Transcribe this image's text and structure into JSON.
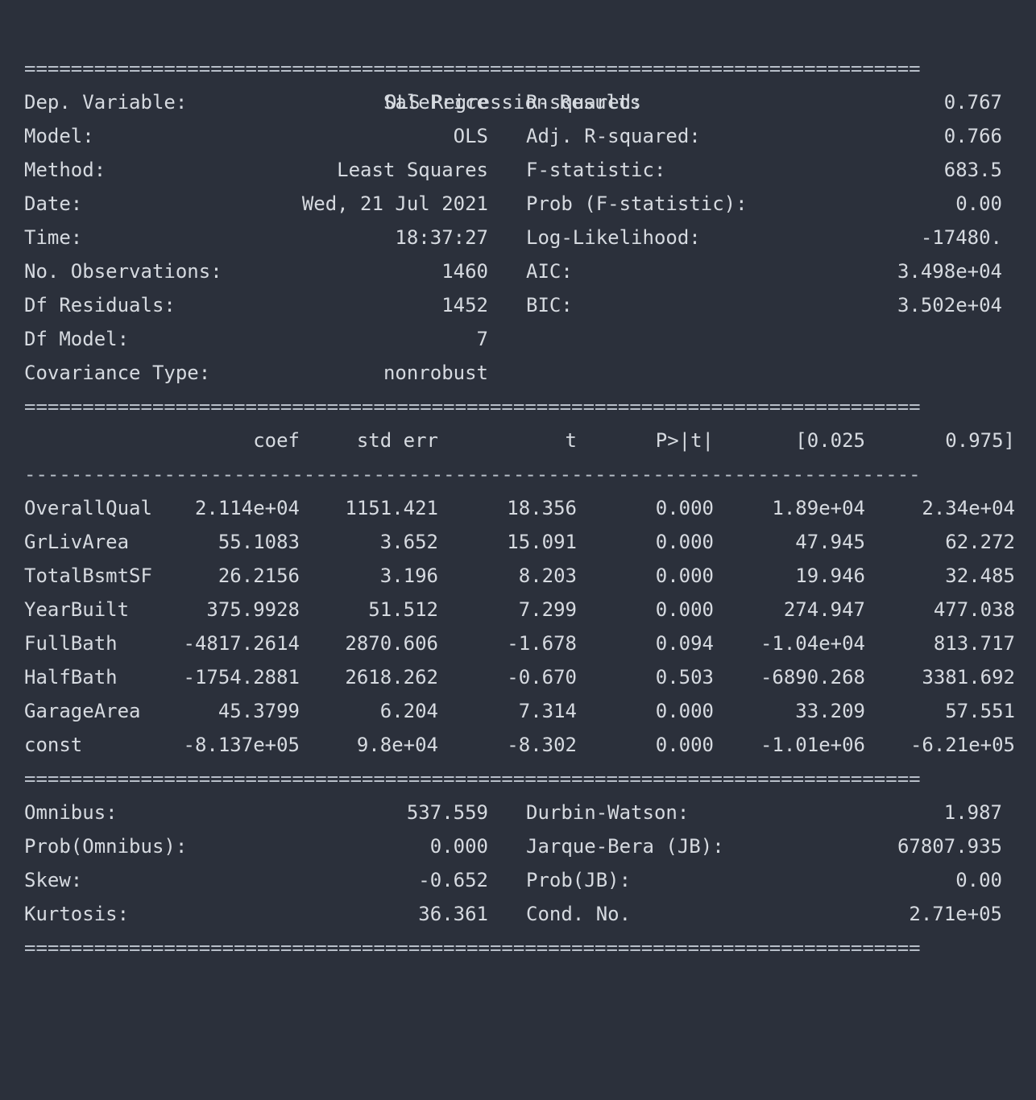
{
  "title": "OLS Regression Results",
  "rule_double": "=============================================================================",
  "rule_single": "-----------------------------------------------------------------------------",
  "top_summary": [
    {
      "label": "Dep. Variable:",
      "value": "SalePrice",
      "label2": "R-squared:",
      "value2": "0.767"
    },
    {
      "label": "Model:",
      "value": "OLS",
      "label2": "Adj. R-squared:",
      "value2": "0.766"
    },
    {
      "label": "Method:",
      "value": "Least Squares",
      "label2": "F-statistic:",
      "value2": "683.5"
    },
    {
      "label": "Date:",
      "value": "Wed, 21 Jul 2021",
      "label2": "Prob (F-statistic):",
      "value2": "0.00"
    },
    {
      "label": "Time:",
      "value": "18:37:27",
      "label2": "Log-Likelihood:",
      "value2": "-17480."
    },
    {
      "label": "No. Observations:",
      "value": "1460",
      "label2": "AIC:",
      "value2": "3.498e+04"
    },
    {
      "label": "Df Residuals:",
      "value": "1452",
      "label2": "BIC:",
      "value2": "3.502e+04"
    },
    {
      "label": "Df Model:",
      "value": "7",
      "label2": "",
      "value2": ""
    },
    {
      "label": "Covariance Type:",
      "value": "nonrobust",
      "label2": "",
      "value2": ""
    }
  ],
  "coef_headers": [
    "",
    "coef",
    "std err",
    "t",
    "P>|t|",
    "[0.025",
    "0.975]"
  ],
  "coef_rows": [
    [
      "OverallQual",
      "2.114e+04",
      "1151.421",
      "18.356",
      "0.000",
      "1.89e+04",
      "2.34e+04"
    ],
    [
      "GrLivArea",
      "55.1083",
      "3.652",
      "15.091",
      "0.000",
      "47.945",
      "62.272"
    ],
    [
      "TotalBsmtSF",
      "26.2156",
      "3.196",
      "8.203",
      "0.000",
      "19.946",
      "32.485"
    ],
    [
      "YearBuilt",
      "375.9928",
      "51.512",
      "7.299",
      "0.000",
      "274.947",
      "477.038"
    ],
    [
      "FullBath",
      "-4817.2614",
      "2870.606",
      "-1.678",
      "0.094",
      "-1.04e+04",
      "813.717"
    ],
    [
      "HalfBath",
      "-1754.2881",
      "2618.262",
      "-0.670",
      "0.503",
      "-6890.268",
      "3381.692"
    ],
    [
      "GarageArea",
      "45.3799",
      "6.204",
      "7.314",
      "0.000",
      "33.209",
      "57.551"
    ],
    [
      "const",
      "-8.137e+05",
      "9.8e+04",
      "-8.302",
      "0.000",
      "-1.01e+06",
      "-6.21e+05"
    ]
  ],
  "bottom_summary": [
    {
      "label": "Omnibus:",
      "value": "537.559",
      "label2": "Durbin-Watson:",
      "value2": "1.987"
    },
    {
      "label": "Prob(Omnibus):",
      "value": "0.000",
      "label2": "Jarque-Bera (JB):",
      "value2": "67807.935"
    },
    {
      "label": "Skew:",
      "value": "-0.652",
      "label2": "Prob(JB):",
      "value2": "0.00"
    },
    {
      "label": "Kurtosis:",
      "value": "36.361",
      "label2": "Cond. No.",
      "value2": "2.71e+05"
    }
  ]
}
